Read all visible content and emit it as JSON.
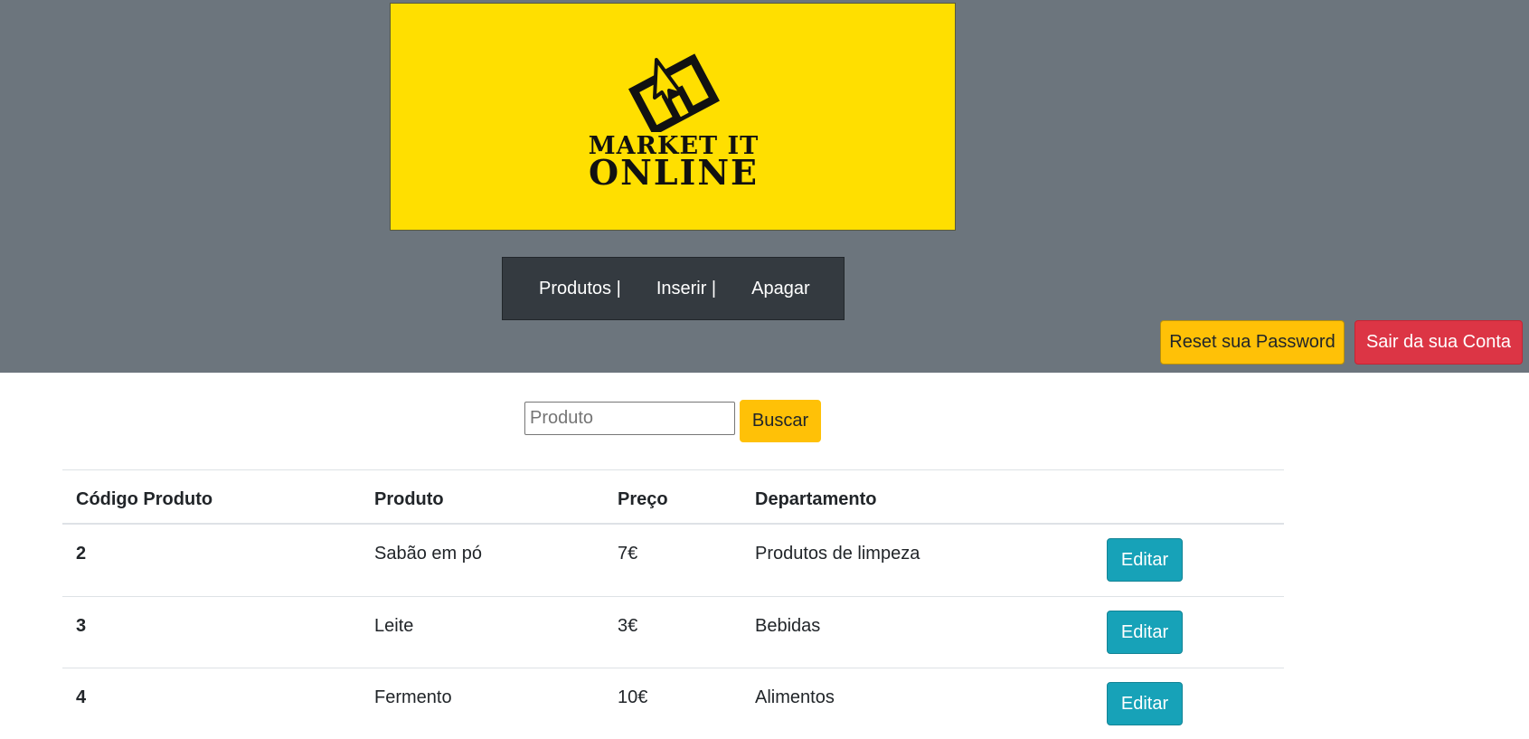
{
  "logo": {
    "line1": "MARKET IT",
    "line2": "ONLINE",
    "background": "#ffdf00"
  },
  "nav": {
    "items": [
      {
        "label": "Produtos |"
      },
      {
        "label": "Inserir |"
      },
      {
        "label": "Apagar"
      }
    ]
  },
  "account": {
    "reset_label": "Reset sua Password",
    "logout_label": "Sair da sua Conta"
  },
  "search": {
    "placeholder": "Produto",
    "value": "",
    "button_label": "Buscar"
  },
  "table": {
    "headers": [
      "Código Produto",
      "Produto",
      "Preço",
      "Departamento",
      ""
    ],
    "rows": [
      {
        "code": "2",
        "product": "Sabão em pó",
        "price": "7€",
        "department": "Produtos de limpeza",
        "action": "Editar"
      },
      {
        "code": "3",
        "product": "Leite",
        "price": "3€",
        "department": "Bebidas",
        "action": "Editar"
      },
      {
        "code": "4",
        "product": "Fermento",
        "price": "10€",
        "department": "Alimentos",
        "action": "Editar"
      }
    ]
  },
  "colors": {
    "header_bg": "#6c757d",
    "nav_bg": "#343a40",
    "warning": "#ffc107",
    "danger": "#dc3545",
    "info": "#17a2b8"
  }
}
